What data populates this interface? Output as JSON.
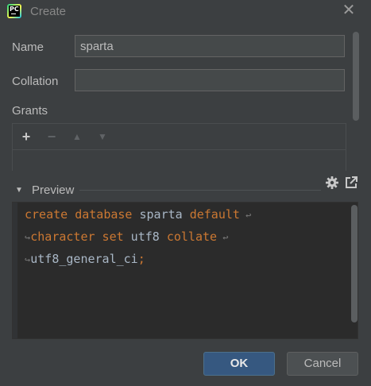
{
  "window": {
    "title": "Create",
    "app_icon_text": "PC"
  },
  "form": {
    "name_label": "Name",
    "name_value": "sparta",
    "collation_label": "Collation",
    "collation_value": "",
    "grants_label": "Grants"
  },
  "grants_toolbar": {
    "add": "+",
    "remove": "−",
    "up": "▲",
    "down": "▼"
  },
  "preview": {
    "label": "Preview",
    "toggle_glyph": "▼",
    "code_lines": [
      [
        {
          "t": "create database",
          "c": "kw"
        },
        {
          "t": " sparta ",
          "c": "id"
        },
        {
          "t": "default",
          "c": "kw"
        },
        {
          "t": " ↩",
          "c": "wrap"
        }
      ],
      [
        {
          "t": "↪",
          "c": "wrap"
        },
        {
          "t": "character set",
          "c": "kw"
        },
        {
          "t": " utf8 ",
          "c": "id"
        },
        {
          "t": "collate",
          "c": "kw"
        },
        {
          "t": " ↩",
          "c": "wrap"
        }
      ],
      [
        {
          "t": "↪",
          "c": "wrap"
        },
        {
          "t": "utf8_general_ci",
          "c": "id"
        },
        {
          "t": ";",
          "c": "kw"
        }
      ]
    ]
  },
  "buttons": {
    "ok": "OK",
    "cancel": "Cancel"
  },
  "colors": {
    "background": "#3c3f41",
    "editor_background": "#2b2b2b",
    "keyword": "#cc7832",
    "identifier": "#a9b7c6",
    "primary_button": "#365880"
  }
}
